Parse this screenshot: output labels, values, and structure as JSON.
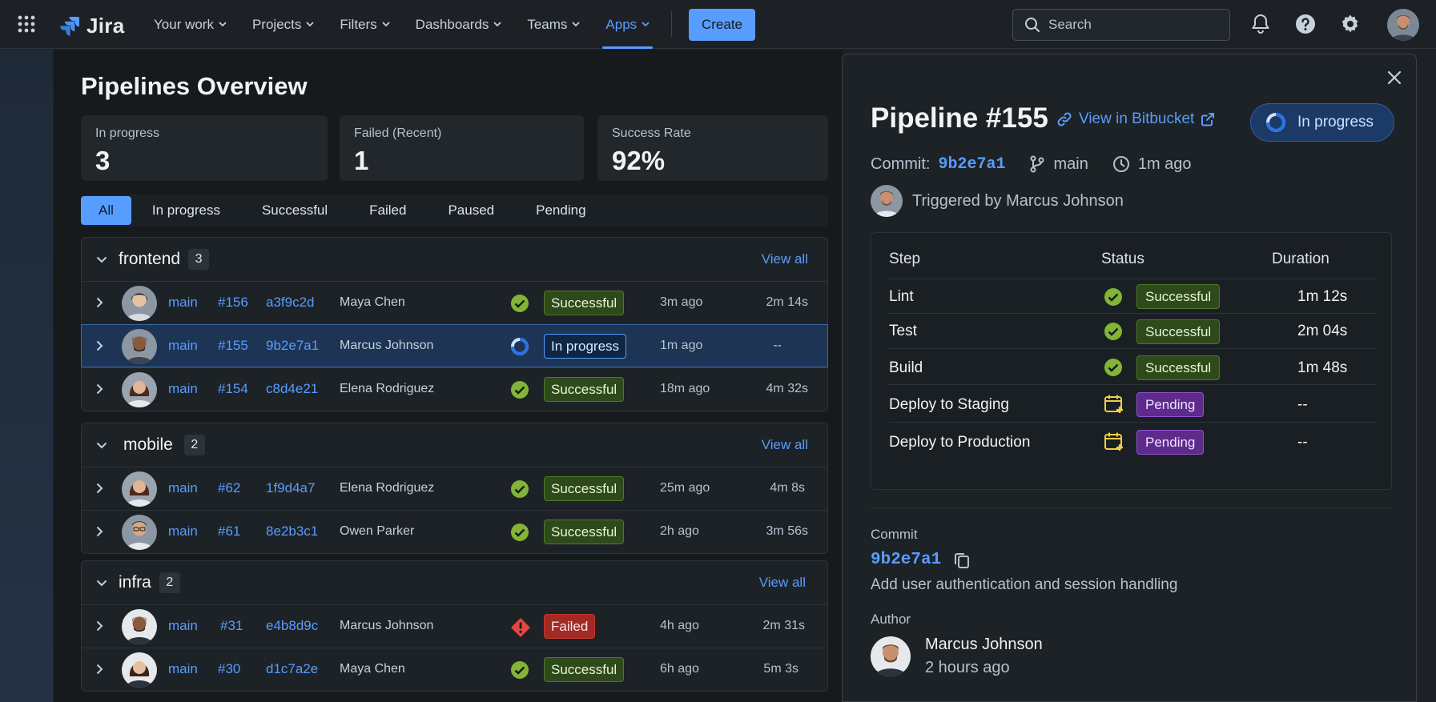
{
  "app": {
    "name": "Jira"
  },
  "nav": [
    {
      "label": "Your work"
    },
    {
      "label": "Projects"
    },
    {
      "label": "Filters"
    },
    {
      "label": "Dashboards"
    },
    {
      "label": "Teams"
    },
    {
      "label": "Apps",
      "active": true
    }
  ],
  "create_label": "Create",
  "search": {
    "placeholder": "Search"
  },
  "page": {
    "title": "Pipelines Overview"
  },
  "stats": [
    {
      "label": "In progress",
      "value": "3"
    },
    {
      "label": "Failed (Recent)",
      "value": "1"
    },
    {
      "label": "Success Rate",
      "value": "92%"
    }
  ],
  "filters": [
    "All",
    "In progress",
    "Successful",
    "Failed",
    "Paused",
    "Pending"
  ],
  "groups": [
    {
      "name": "frontend",
      "count": "3",
      "view_all": "View all",
      "rows": [
        {
          "branch": "main",
          "num": "#156",
          "sha": "a3f9c2d",
          "author": "Maya Chen",
          "status": "Successful",
          "ago": "3m ago",
          "duration": "2m 14s"
        },
        {
          "branch": "main",
          "num": "#155",
          "sha": "9b2e7a1",
          "author": "Marcus Johnson",
          "status": "In progress",
          "ago": "1m ago",
          "duration": "--"
        },
        {
          "branch": "main",
          "num": "#154",
          "sha": "c8d4e21",
          "author": "Elena Rodriguez",
          "status": "Successful",
          "ago": "18m ago",
          "duration": "4m 32s"
        }
      ]
    },
    {
      "name": "mobile",
      "count": "2",
      "view_all": "View all",
      "rows": [
        {
          "branch": "main",
          "num": "#62",
          "sha": "1f9d4a7",
          "author": "Elena Rodriguez",
          "status": "Successful",
          "ago": "25m ago",
          "duration": "4m 8s"
        },
        {
          "branch": "main",
          "num": "#61",
          "sha": "8e2b3c1",
          "author": "Owen Parker",
          "status": "Successful",
          "ago": "2h ago",
          "duration": "3m 56s"
        }
      ]
    },
    {
      "name": "infra",
      "count": "2",
      "view_all": "View all",
      "rows": [
        {
          "branch": "main",
          "num": "#31",
          "sha": "e4b8d9c",
          "author": "Marcus Johnson",
          "status": "Failed",
          "ago": "4h ago",
          "duration": "2m 31s"
        },
        {
          "branch": "main",
          "num": "#30",
          "sha": "d1c7a2e",
          "author": "Maya Chen",
          "status": "Successful",
          "ago": "6h ago",
          "duration": "5m 3s"
        }
      ]
    }
  ],
  "panel": {
    "title": "Pipeline #155",
    "view_link": "View in Bitbucket",
    "status": "In progress",
    "commit_label": "Commit:",
    "commit_sha": "9b2e7a1",
    "branch": "main",
    "time": "1m ago",
    "triggered_by": "Triggered by Marcus Johnson",
    "steps_header": {
      "step": "Step",
      "status": "Status",
      "duration": "Duration"
    },
    "steps": [
      {
        "name": "Lint",
        "status": "Successful",
        "duration": "1m 12s"
      },
      {
        "name": "Test",
        "status": "Successful",
        "duration": "2m 04s"
      },
      {
        "name": "Build",
        "status": "Successful",
        "duration": "1m 48s"
      },
      {
        "name": "Deploy to Staging",
        "status": "Pending",
        "duration": "--"
      },
      {
        "name": "Deploy to Production",
        "status": "Pending",
        "duration": "--"
      }
    ],
    "commit_section_label": "Commit",
    "commit_message": "Add user authentication and session handling",
    "author_label": "Author",
    "author_name": "Marcus Johnson",
    "author_time": "2 hours ago"
  },
  "colors": {
    "accent": "#579dff",
    "success": "#82b536",
    "failed": "#e2483d",
    "pending": "#f5cd47",
    "in_progress": "#579dff"
  }
}
